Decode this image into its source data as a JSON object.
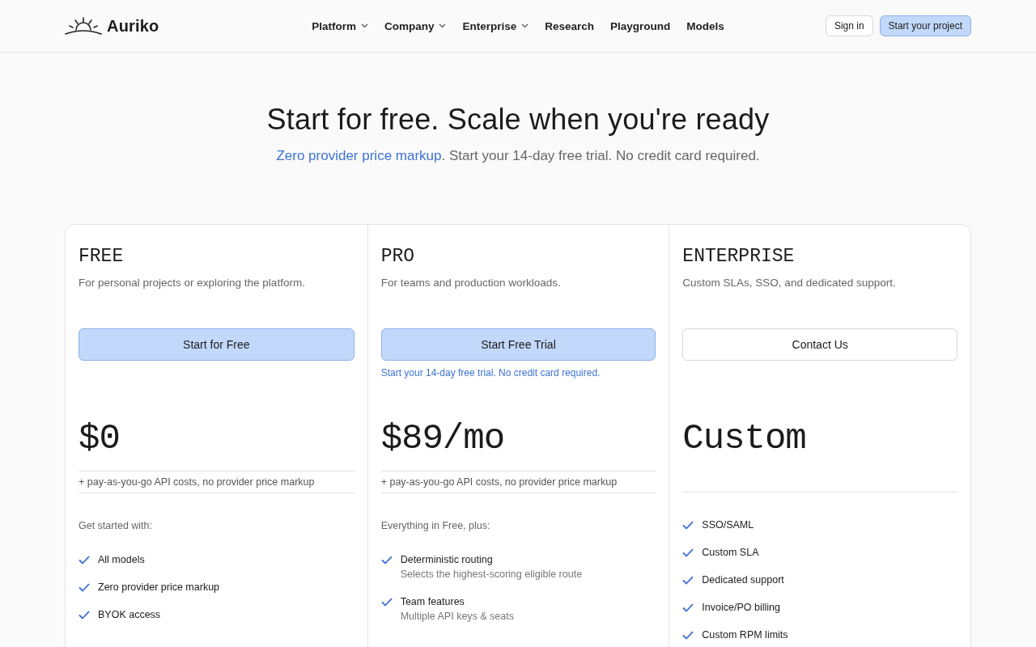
{
  "brand": {
    "name": "Auriko"
  },
  "nav": [
    {
      "label": "Platform",
      "dropdown": true
    },
    {
      "label": "Company",
      "dropdown": true
    },
    {
      "label": "Enterprise",
      "dropdown": true
    },
    {
      "label": "Research",
      "dropdown": false
    },
    {
      "label": "Playground",
      "dropdown": false
    },
    {
      "label": "Models",
      "dropdown": false
    }
  ],
  "header_buttons": [
    {
      "label": "Sign in",
      "kind": "outline"
    },
    {
      "label": "Start your project",
      "kind": "primary"
    }
  ],
  "hero": {
    "title": "Start for free. Scale when you're ready",
    "link": "Zero provider price markup",
    "subtitle": ". Start your 14-day free trial. No credit card required."
  },
  "plans": [
    {
      "name": "FREE",
      "description": "For personal projects or exploring the platform.",
      "button": {
        "label": "Start for Free",
        "kind": "primary"
      },
      "price": "$0",
      "price_note": "+ pay-as-you-go API costs, no provider price markup",
      "intro": "Get started with:",
      "features": [
        {
          "text": "All models"
        },
        {
          "text": "Zero provider price markup"
        },
        {
          "text": "BYOK access"
        }
      ]
    },
    {
      "name": "PRO",
      "description": "For teams and production workloads.",
      "button": {
        "label": "Start Free Trial",
        "kind": "primary"
      },
      "button_note": "Start your 14-day free trial. No credit card required.",
      "price": "$89/mo",
      "price_note": "+ pay-as-you-go API costs, no provider price markup",
      "intro": "Everything in Free, plus:",
      "features": [
        {
          "text": "Deterministic routing",
          "detail": "Selects the highest-scoring eligible route"
        },
        {
          "text": "Team features",
          "detail": "Multiple API keys & seats"
        }
      ]
    },
    {
      "name": "ENTERPRISE",
      "description": "Custom SLAs, SSO, and dedicated support.",
      "button": {
        "label": "Contact Us",
        "kind": "outline"
      },
      "price": "Custom",
      "features": [
        {
          "text": "SSO/SAML"
        },
        {
          "text": "Custom SLA"
        },
        {
          "text": "Dedicated support"
        },
        {
          "text": "Invoice/PO billing"
        },
        {
          "text": "Custom RPM limits"
        }
      ]
    }
  ]
}
